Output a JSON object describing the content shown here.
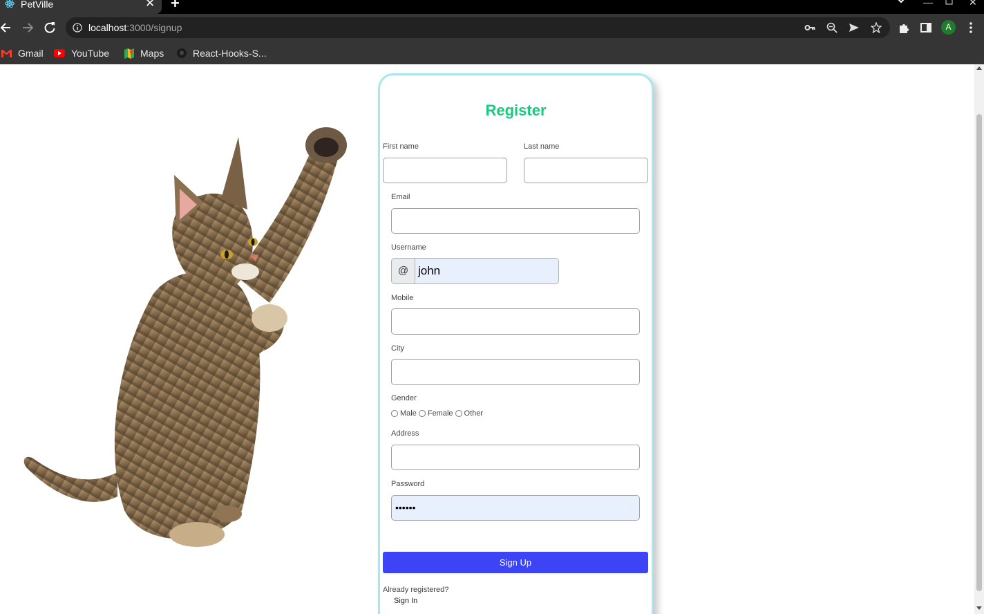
{
  "browser": {
    "tab_title": "PetVille",
    "tab_close": "✕",
    "new_tab": "+",
    "url_host": "localhost",
    "url_path": ":3000/signup",
    "avatar_letter": "A",
    "icons": [
      "react-favicon",
      "back-icon",
      "forward-icon",
      "reload-icon",
      "info-icon",
      "key-icon",
      "zoom-icon",
      "send-icon",
      "star-icon",
      "extensions-icon",
      "sidebar-icon",
      "menu-icon"
    ]
  },
  "bookmarks": [
    {
      "label": "Gmail",
      "icon": "gmail-icon"
    },
    {
      "label": "YouTube",
      "icon": "youtube-icon"
    },
    {
      "label": "Maps",
      "icon": "maps-icon"
    },
    {
      "label": "React-Hooks-S...",
      "icon": "github-icon"
    }
  ],
  "form": {
    "title": "Register",
    "first_name_label": "First name",
    "last_name_label": "Last name",
    "email_label": "Email",
    "username_label": "Username",
    "username_addon": "@",
    "username_value": "john",
    "mobile_label": "Mobile",
    "city_label": "City",
    "gender_label": "Gender",
    "gender_options": [
      "Male",
      "Female",
      "Other"
    ],
    "address_label": "Address",
    "password_label": "Password",
    "password_value": "••••••",
    "submit_label": "Sign Up",
    "already_text": "Already registered?",
    "signin_label": "Sign In"
  },
  "colors": {
    "title_green": "#1cc780",
    "button_blue": "#3d44f5",
    "card_border": "#a6e7f0",
    "autofill_bg": "#e8f0fe",
    "chrome_dark": "#353535"
  }
}
